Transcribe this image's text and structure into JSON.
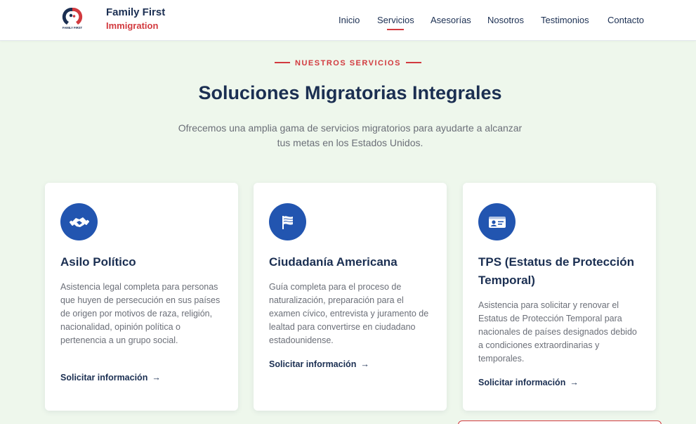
{
  "brand": {
    "name": "Family First",
    "sub": "Immigration",
    "logo_text": "FAMILY FIRST"
  },
  "nav": {
    "items": [
      "Inicio",
      "Servicios",
      "Asesorías",
      "Nosotros",
      "Testimonios",
      "Contacto"
    ],
    "active": "Servicios"
  },
  "intro": {
    "eyebrow": "NUESTROS SERVICIOS",
    "title": "Soluciones Migratorias Integrales",
    "subtitle": "Ofrecemos una amplia gama de servicios migratorios para ayudarte a alcanzar tus metas en los Estados Unidos."
  },
  "cards": [
    {
      "icon": "handshake-icon",
      "title": "Asilo Político",
      "text": "Asistencia legal completa para personas que huyen de persecución en sus países de origen por motivos de raza, religión, nacionalidad, opinión política o pertenencia a un grupo social.",
      "link": "Solicitar información"
    },
    {
      "icon": "flag-icon",
      "title": "Ciudadanía Americana",
      "text": "Guía completa para el proceso de naturalización, preparación para el examen cívico, entrevista y juramento de lealtad para convertirse en ciudadano estadounidense.",
      "link": "Solicitar información"
    },
    {
      "icon": "id-card-icon",
      "title": "TPS (Estatus de Protección Temporal)",
      "text": "Asistencia para solicitar y renovar el Estatus de Protección Temporal para nacionales de países designados debido a condiciones extraordinarias y temporales.",
      "link": "Solicitar información"
    }
  ],
  "colors": {
    "primary": "#1b2f52",
    "accent": "#d23a3f",
    "icon_bg": "#2255b0",
    "page_bg": "#eef7ec"
  },
  "link_arrow": "→"
}
